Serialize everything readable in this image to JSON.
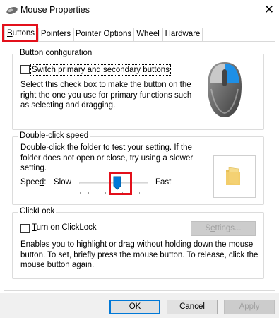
{
  "window": {
    "title": "Mouse Properties",
    "close_glyph": "✕"
  },
  "tabs": [
    {
      "label": "Buttons",
      "active": true
    },
    {
      "label": "Pointers",
      "active": false
    },
    {
      "label": "Pointer Options",
      "active": false
    },
    {
      "label": "Wheel",
      "active": false
    },
    {
      "label": "Hardware",
      "active": false
    }
  ],
  "button_configuration": {
    "legend": "Button configuration",
    "checkbox_label": "Switch primary and secondary buttons",
    "checked": false,
    "description_lines": [
      "Select this check box to make the button on the",
      "right the one you use for primary functions such",
      "as selecting and dragging."
    ],
    "icon": "mouse-icon"
  },
  "double_click": {
    "legend": "Double-click speed",
    "description_lines": [
      "Double-click the folder to test your setting. If the",
      "folder does not open or close, try using a slower",
      "setting."
    ],
    "speed_label": "Speed:",
    "slow_label": "Slow",
    "fast_label": "Fast",
    "speed_level_fraction": 0.55,
    "test_icon": "folder-icon"
  },
  "clicklock": {
    "legend": "ClickLock",
    "checkbox_label": "Turn on ClickLock",
    "checked": false,
    "settings_button": "Settings...",
    "description_lines": [
      "Enables you to highlight or drag without holding down the mouse",
      "button. To set, briefly press the mouse button. To release, click the",
      "mouse button again."
    ]
  },
  "footer": {
    "ok": "OK",
    "cancel": "Cancel",
    "apply": "Apply"
  },
  "colors": {
    "highlight_box": "#e3101b",
    "accent": "#0078d7"
  }
}
